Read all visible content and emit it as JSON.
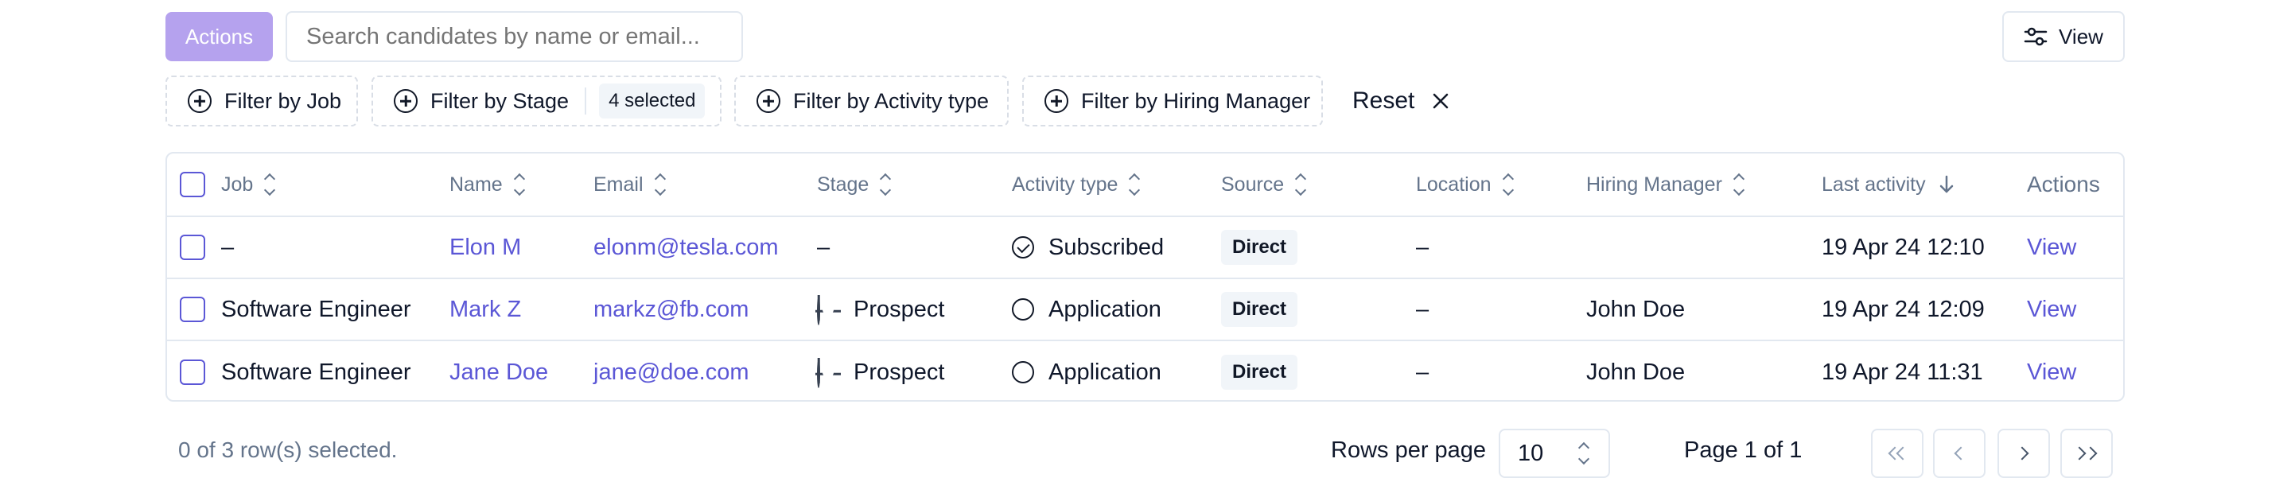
{
  "toolbar": {
    "actions_label": "Actions",
    "search_placeholder": "Search candidates by name or email...",
    "view_label": "View"
  },
  "filters": {
    "job": "Filter by Job",
    "stage": "Filter by Stage",
    "stage_selected": "4 selected",
    "activity": "Filter by Activity type",
    "manager": "Filter by Hiring Manager",
    "reset": "Reset"
  },
  "table": {
    "headers": {
      "job": "Job",
      "name": "Name",
      "email": "Email",
      "stage": "Stage",
      "activity": "Activity type",
      "source": "Source",
      "location": "Location",
      "manager": "Hiring Manager",
      "last_activity": "Last activity",
      "actions": "Actions"
    },
    "rows": [
      {
        "job": "–",
        "name": "Elon M",
        "email": "elonm@tesla.com",
        "stage": "–",
        "activity": "Subscribed",
        "source": "Direct",
        "location": "–",
        "manager": "",
        "last_activity": "19 Apr 24 12:10",
        "action": "View"
      },
      {
        "job": "Software Engineer",
        "name": "Mark Z",
        "email": "markz@fb.com",
        "stage": "Prospect",
        "activity": "Application",
        "source": "Direct",
        "location": "–",
        "manager": "John Doe",
        "last_activity": "19 Apr 24 12:09",
        "action": "View"
      },
      {
        "job": "Software Engineer",
        "name": "Jane Doe",
        "email": "jane@doe.com",
        "stage": "Prospect",
        "activity": "Application",
        "source": "Direct",
        "location": "–",
        "manager": "John Doe",
        "last_activity": "19 Apr 24 11:31",
        "action": "View"
      }
    ]
  },
  "footer": {
    "selection": "0 of 3 row(s) selected.",
    "rows_per_page_label": "Rows per page",
    "rows_per_page_value": "10",
    "page_label": "Page 1 of 1"
  },
  "colors": {
    "accent": "#5b57d6",
    "actions_button": "#b5a2ee",
    "border": "#e2e8f0",
    "muted_text": "#64748b"
  }
}
